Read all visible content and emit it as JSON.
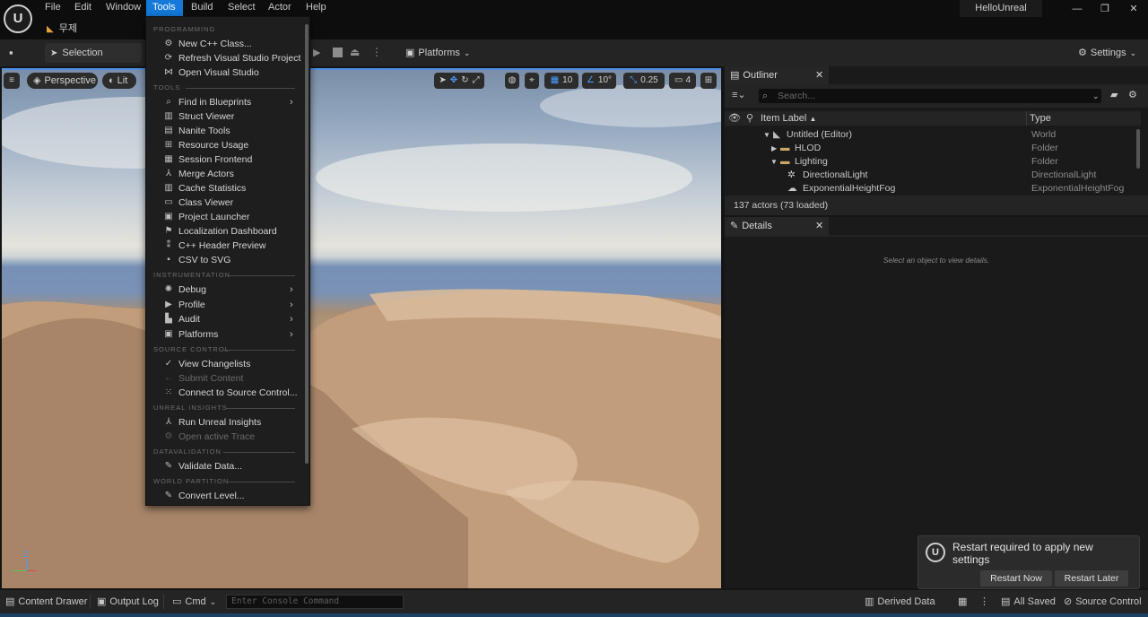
{
  "app": {
    "title": "HelloUnreal",
    "logo_glyph": "U"
  },
  "menubar": [
    "File",
    "Edit",
    "Window",
    "Tools",
    "Build",
    "Select",
    "Actor",
    "Help"
  ],
  "document_tab": {
    "label": "무제"
  },
  "toolbar": {
    "selection_mode": "Selection Mode",
    "platforms": "Platforms",
    "settings": "Settings"
  },
  "viewport": {
    "perspective": "Perspective",
    "lit": "Lit",
    "grid_snap": "10",
    "angle_snap": "10°",
    "scale_snap": "0.25",
    "camera_speed": "4"
  },
  "tools_menu": {
    "sections": [
      {
        "title": "PROGRAMMING",
        "items": [
          {
            "label": "New C++ Class...",
            "icon": "class-icon"
          },
          {
            "label": "Refresh Visual Studio Project",
            "icon": "refresh-icon"
          },
          {
            "label": "Open Visual Studio",
            "icon": "visual-studio-icon"
          }
        ]
      },
      {
        "title": "TOOLS",
        "items": [
          {
            "label": "Find in Blueprints",
            "icon": "search-icon",
            "submenu": true
          },
          {
            "label": "Struct Viewer",
            "icon": "struct-icon"
          },
          {
            "label": "Nanite Tools",
            "icon": "nanite-icon"
          },
          {
            "label": "Resource Usage",
            "icon": "table-icon"
          },
          {
            "label": "Session Frontend",
            "icon": "session-icon"
          },
          {
            "label": "Merge Actors",
            "icon": "merge-icon"
          },
          {
            "label": "Cache Statistics",
            "icon": "stats-icon"
          },
          {
            "label": "Class Viewer",
            "icon": "class-viewer-icon"
          },
          {
            "label": "Project Launcher",
            "icon": "launcher-icon"
          },
          {
            "label": "Localization Dashboard",
            "icon": "flag-icon"
          },
          {
            "label": "C++ Header Preview",
            "icon": "header-icon"
          },
          {
            "label": "CSV to SVG",
            "icon": "csv-icon"
          }
        ]
      },
      {
        "title": "INSTRUMENTATION",
        "items": [
          {
            "label": "Debug",
            "icon": "debug-icon",
            "submenu": true
          },
          {
            "label": "Profile",
            "icon": "profile-icon",
            "submenu": true
          },
          {
            "label": "Audit",
            "icon": "audit-icon",
            "submenu": true
          },
          {
            "label": "Platforms",
            "icon": "platforms-icon",
            "submenu": true
          }
        ]
      },
      {
        "title": "SOURCE CONTROL",
        "items": [
          {
            "label": "View Changelists",
            "icon": "check-circle-icon"
          },
          {
            "label": "Submit Content",
            "icon": "arrow-left-icon",
            "disabled": true
          },
          {
            "label": "Connect to Source Control...",
            "icon": "connect-icon"
          }
        ]
      },
      {
        "title": "UNREAL INSIGHTS",
        "items": [
          {
            "label": "Run Unreal Insights",
            "icon": "insights-icon"
          },
          {
            "label": "Open active Trace",
            "icon": "trace-icon",
            "disabled": true
          }
        ]
      },
      {
        "title": "DATAVALIDATION",
        "items": [
          {
            "label": "Validate Data...",
            "icon": "validate-icon"
          }
        ]
      },
      {
        "title": "WORLD PARTITION",
        "items": [
          {
            "label": "Convert Level...",
            "icon": "convert-icon"
          }
        ]
      }
    ]
  },
  "outliner": {
    "tab": "Outliner",
    "search_placeholder": "Search...",
    "columns": {
      "label": "Item Label",
      "type": "Type"
    },
    "rows": [
      {
        "label": "Untitled (Editor)",
        "type": "World"
      },
      {
        "label": "HLOD",
        "type": "Folder"
      },
      {
        "label": "Lighting",
        "type": "Folder"
      },
      {
        "label": "DirectionalLight",
        "type": "DirectionalLight"
      },
      {
        "label": "ExponentialHeightFog",
        "type": "ExponentialHeightFog"
      }
    ],
    "count": "137 actors (73 loaded)"
  },
  "details": {
    "tab": "Details",
    "empty": "Select an object to view details."
  },
  "statusbar": {
    "content_drawer": "Content Drawer",
    "output_log": "Output Log",
    "cmd": "Cmd",
    "console_placeholder": "Enter Console Command",
    "derived_data": "Derived Data",
    "all_saved": "All Saved",
    "source_control": "Source Control"
  },
  "toast": {
    "message": "Restart required to apply new settings",
    "restart_now": "Restart Now",
    "restart_later": "Restart Later"
  },
  "colors": {
    "accent": "#1479d9",
    "menu_bg": "#1e1e1e",
    "panel_bg": "#1a1a1a"
  }
}
